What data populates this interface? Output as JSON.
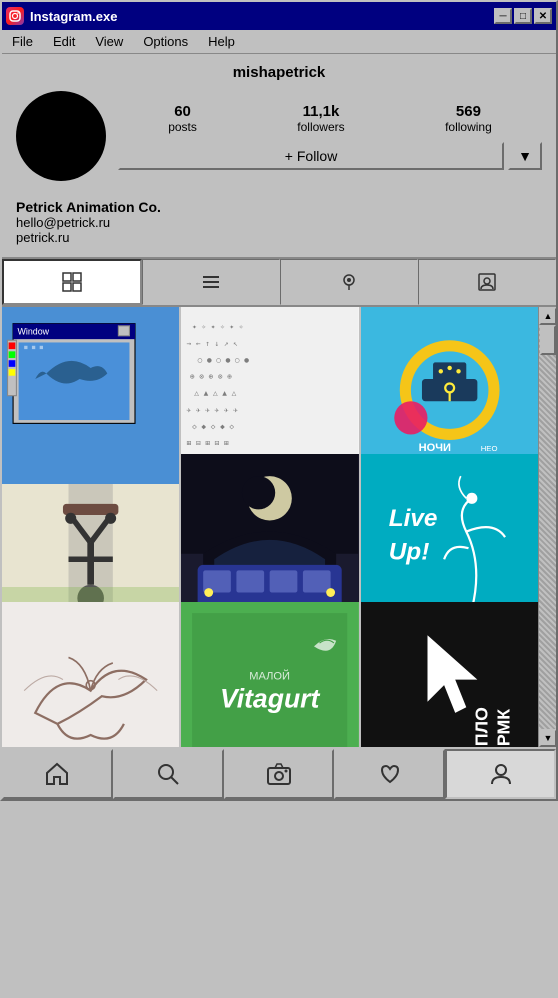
{
  "window": {
    "title": "Instagram.exe",
    "icon": "📷",
    "controls": {
      "minimize": "─",
      "maximize": "□",
      "close": "✕"
    }
  },
  "menubar": {
    "items": [
      "File",
      "Edit",
      "View",
      "Options",
      "Help"
    ]
  },
  "profile": {
    "username": "mishapetrick",
    "stats": {
      "posts": {
        "value": "60",
        "label": "posts"
      },
      "followers": {
        "value": "11,1k",
        "label": "followers"
      },
      "following": {
        "value": "569",
        "label": "following"
      }
    },
    "follow_button": "+ Follow",
    "dropdown_arrow": "▼",
    "bio_name": "Petrick Animation Co.",
    "bio_email": "hello@petrick.ru",
    "bio_website": "petrick.ru"
  },
  "tabs": [
    {
      "id": "grid",
      "icon": "⊞",
      "active": true
    },
    {
      "id": "list",
      "icon": "≡",
      "active": false
    },
    {
      "id": "location",
      "icon": "◎",
      "active": false
    },
    {
      "id": "person",
      "icon": "⊡",
      "active": false
    }
  ],
  "navbar": {
    "items": [
      {
        "id": "home",
        "icon": "⌂"
      },
      {
        "id": "search",
        "icon": "🔍"
      },
      {
        "id": "camera",
        "icon": "📷"
      },
      {
        "id": "heart",
        "icon": "♥"
      },
      {
        "id": "profile",
        "icon": "👤"
      }
    ]
  },
  "scrollbar": {
    "up_arrow": "▲",
    "down_arrow": "▼"
  }
}
